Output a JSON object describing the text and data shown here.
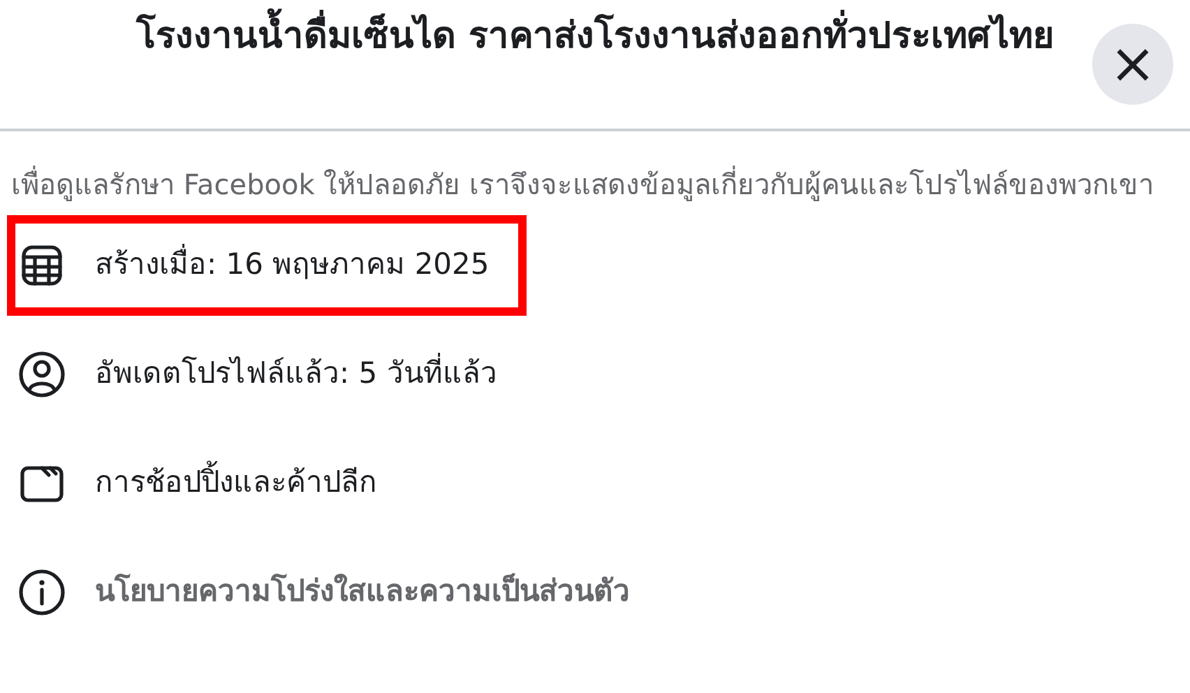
{
  "dialog": {
    "title": "โรงงานน้ำดื่มเซ็นได ราคาส่งโรงงานส่งออกทั่วประเทศไทย",
    "close_label": "×"
  },
  "description": "เพื่อดูแลรักษา Facebook ให้ปลอดภัย เราจึงจะแสดงข้อมูลเกี่ยวกับผู้คนและโปรไฟล์ของพวกเขา",
  "items": [
    {
      "kind": "created",
      "text": "สร้างเมื่อ: 16 พฤษภาคม 2025",
      "highlighted": true
    },
    {
      "kind": "updated",
      "text": "อัพเดตโปรไฟล์แล้ว: 5 วันที่แล้ว",
      "highlighted": false
    },
    {
      "kind": "category",
      "text": "การช้อปปิ้งและค้าปลีก",
      "highlighted": false
    },
    {
      "kind": "policy",
      "text": "นโยบายความโปร่งใสและความเป็นส่วนตัว",
      "highlighted": false
    }
  ]
}
